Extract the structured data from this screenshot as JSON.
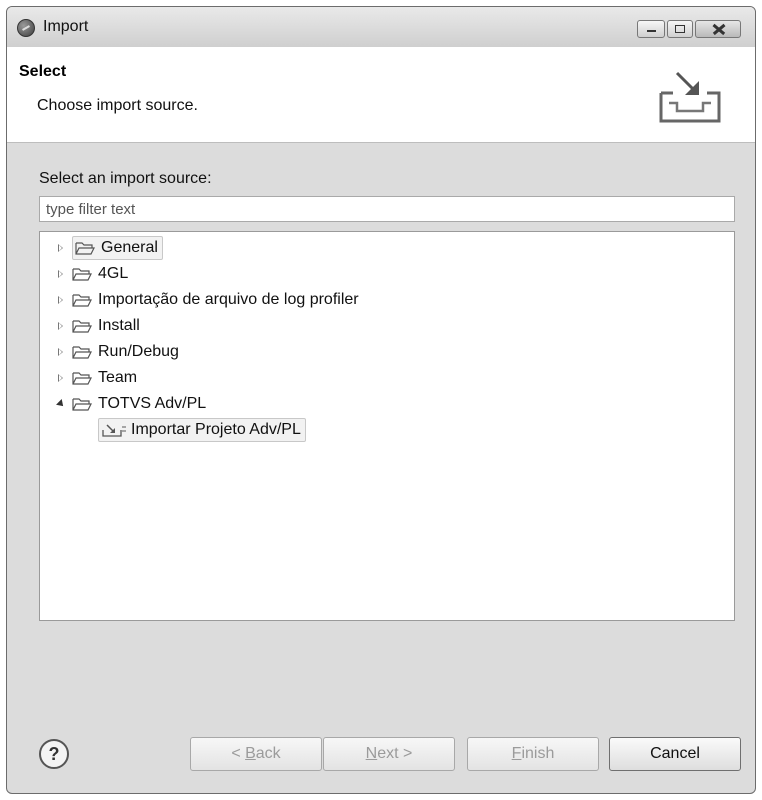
{
  "window": {
    "title": "Import"
  },
  "header": {
    "title": "Select",
    "description": "Choose import source."
  },
  "source": {
    "label": "Select an import source:",
    "filter_placeholder": "type filter text"
  },
  "tree": {
    "items": [
      {
        "label": "General",
        "state": "collapsed",
        "selected": true
      },
      {
        "label": "4GL",
        "state": "collapsed"
      },
      {
        "label": "Importação de arquivo de log profiler",
        "state": "collapsed"
      },
      {
        "label": "Install",
        "state": "collapsed"
      },
      {
        "label": "Run/Debug",
        "state": "collapsed"
      },
      {
        "label": "Team",
        "state": "collapsed"
      },
      {
        "label": "TOTVS Adv/PL",
        "state": "expanded"
      }
    ],
    "child": {
      "label": "Importar Projeto Adv/PL"
    }
  },
  "buttons": {
    "help": "?",
    "back_rest": " < ",
    "back_u": "B",
    "back_tail": "ack",
    "next_u": "N",
    "next_tail": "ext >",
    "finish_u": "F",
    "finish_tail": "inish",
    "cancel": "Cancel"
  },
  "icons": {
    "app": "eclipse-icon",
    "banner": "import-wizard-icon",
    "folder": "folder-icon",
    "child": "import-project-icon",
    "help": "help-icon"
  }
}
